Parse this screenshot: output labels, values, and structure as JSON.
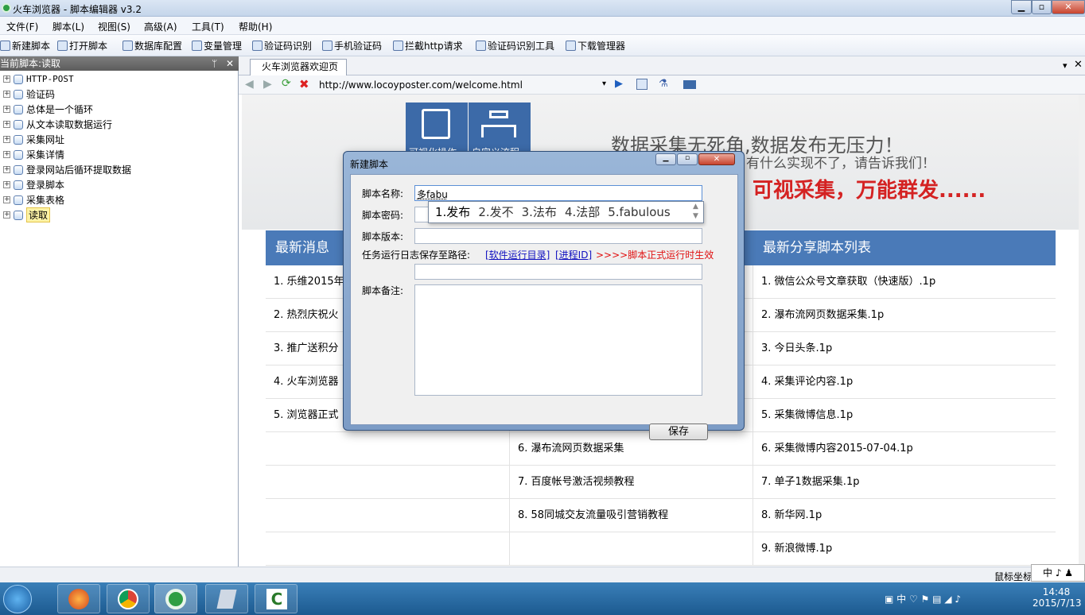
{
  "window": {
    "title": "火车浏览器 - 脚本编辑器 v3.2"
  },
  "menu": [
    "文件(F)",
    "脚本(L)",
    "视图(S)",
    "高级(A)",
    "工具(T)",
    "帮助(H)"
  ],
  "toolbar": [
    "新建脚本",
    "打开脚本",
    "数据库配置",
    "变量管理",
    "验证码识别",
    "手机验证码",
    "拦截http请求",
    "验证码识别工具",
    "下载管理器"
  ],
  "left_panel": {
    "header": "当前脚本:读取",
    "pin": "ᛘ",
    "close": "✕",
    "items": [
      "HTTP-POST",
      "验证码",
      "总体是一个循环",
      "从文本读取数据运行",
      "采集网址",
      "采集详情",
      "登录网站后循环提取数据",
      "登录脚本",
      "采集表格",
      "读取"
    ]
  },
  "browser": {
    "tab": "火车浏览器欢迎页",
    "url": "http://www.locoyposter.com/welcome.html"
  },
  "webpage": {
    "icon_labels": [
      "可视化操作",
      "自定义流程"
    ],
    "slogan1": "数据采集无死角,数据发布无压力！",
    "slogan2": "有什么实现不了，请告诉我们！",
    "slogan3": "可视采集，万能群发......",
    "col1_header": "最新消息",
    "col3_header": "最新分享脚本列表",
    "news": [
      "1. 乐维2015年",
      "2. 热烈庆祝火",
      "3. 推广送积分",
      "4. 火车浏览器",
      "5. 浏览器正式"
    ],
    "tutorials": [
      "6. 瀑布流网页数据采集",
      "7. 百度帐号激活视频教程",
      "8. 58同城交友流量吸引营销教程"
    ],
    "shared": [
      "1. 微信公众号文章获取（快速版）.1p",
      "2. 瀑布流网页数据采集.1p",
      "3. 今日头条.1p",
      "4. 采集评论内容.1p",
      "5. 采集微博信息.1p",
      "6. 采集微博内容2015-07-04.1p",
      "7. 单子1数据采集.1p",
      "8. 新华网.1p",
      "9. 新浪微博.1p"
    ]
  },
  "dialog": {
    "title": "新建脚本",
    "name_label": "脚本名称:",
    "name_value": "多fabu",
    "password_label": "脚本密码:",
    "version_label": "脚本版本:",
    "log_label": "任务运行日志保存至路径:",
    "link1": "[软件运行目录]",
    "link2": "[进程ID]",
    "note": ">>>>脚本正式运行时生效",
    "remark_label": "脚本备注:",
    "save": "保存"
  },
  "ime": {
    "candidates": [
      "1.发布",
      "2.发不",
      "3.法布",
      "4.法部",
      "5.fabulous"
    ]
  },
  "statusbar": {
    "text": "鼠标坐标",
    "ime_mode": "中"
  },
  "tray": {
    "time": "14:48",
    "date": "2015/7/13",
    "lang": "中"
  }
}
